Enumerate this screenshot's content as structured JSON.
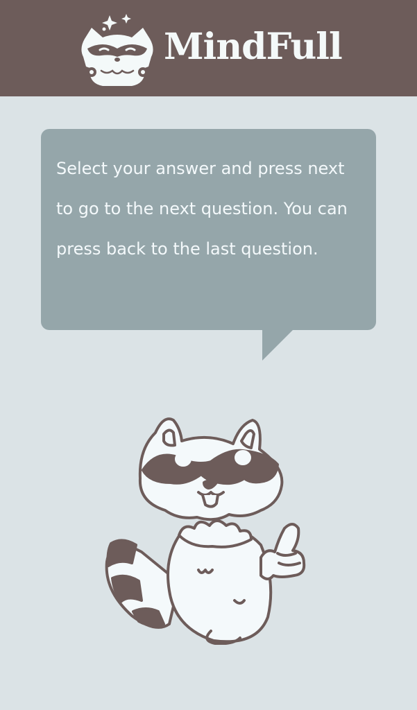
{
  "header": {
    "app_name": "MindFull",
    "logo_icon": "raccoon-logo-icon",
    "background_color": "#6d5c5a"
  },
  "instructions": {
    "text": "Select your answer and press next to go to the next question. You can press back to the last question."
  },
  "mascot": {
    "icon": "raccoon-thumbs-up-icon"
  },
  "colors": {
    "page_background": "#dbe3e6",
    "bubble_background": "#95a6aa",
    "text_light": "#f4f9fb",
    "outline": "#6d5c5a"
  }
}
